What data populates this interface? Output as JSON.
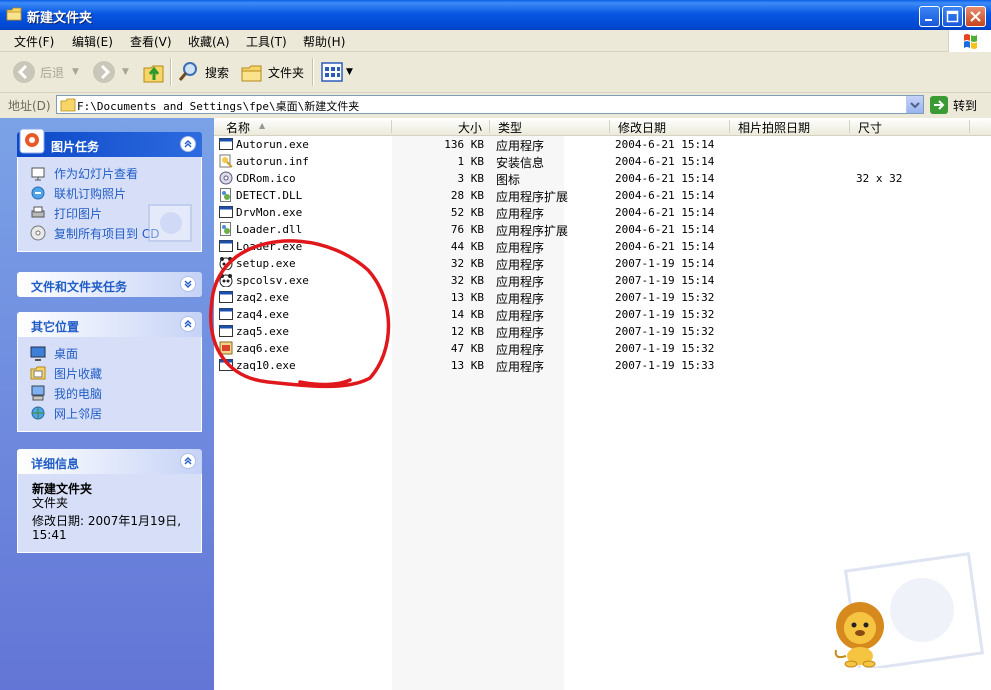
{
  "window": {
    "title": "新建文件夹"
  },
  "menu": [
    "文件(F)",
    "编辑(E)",
    "查看(V)",
    "收藏(A)",
    "工具(T)",
    "帮助(H)"
  ],
  "toolbar": {
    "back": "后退",
    "search": "搜索",
    "folders": "文件夹"
  },
  "address": {
    "label": "地址(D)",
    "path": "F:\\Documents and Settings\\fpe\\桌面\\新建文件夹",
    "go": "转到"
  },
  "left": {
    "picture_tasks": {
      "title": "图片任务",
      "items": [
        "作为幻灯片查看",
        "联机订购照片",
        "打印图片",
        "复制所有项目到 CD"
      ]
    },
    "file_tasks": {
      "title": "文件和文件夹任务"
    },
    "other_places": {
      "title": "其它位置",
      "items": [
        "桌面",
        "图片收藏",
        "我的电脑",
        "网上邻居"
      ]
    },
    "details": {
      "title": "详细信息",
      "name": "新建文件夹",
      "type": "文件夹",
      "modified_label": "修改日期: 2007年1月19日,",
      "modified_time": "15:41"
    }
  },
  "columns": [
    "名称",
    "大小",
    "类型",
    "修改日期",
    "相片拍照日期",
    "尺寸"
  ],
  "files": [
    {
      "name": "Autorun.exe",
      "size": "136 KB",
      "type": "应用程序",
      "date": "2004-6-21 15:14",
      "dim": "",
      "icon": "exe-window-icon"
    },
    {
      "name": "autorun.inf",
      "size": "1 KB",
      "type": "安装信息",
      "date": "2004-6-21 15:14",
      "dim": "",
      "icon": "inf-setup-icon"
    },
    {
      "name": "CDRom.ico",
      "size": "3 KB",
      "type": "图标",
      "date": "2004-6-21 15:14",
      "dim": "32 x 32",
      "icon": "cd-icon"
    },
    {
      "name": "DETECT.DLL",
      "size": "28 KB",
      "type": "应用程序扩展",
      "date": "2004-6-21 15:14",
      "dim": "",
      "icon": "dll-icon"
    },
    {
      "name": "DrvMon.exe",
      "size": "52 KB",
      "type": "应用程序",
      "date": "2004-6-21 15:14",
      "dim": "",
      "icon": "exe-window-icon"
    },
    {
      "name": "Loader.dll",
      "size": "76 KB",
      "type": "应用程序扩展",
      "date": "2004-6-21 15:14",
      "dim": "",
      "icon": "dll-icon"
    },
    {
      "name": "Loader.exe",
      "size": "44 KB",
      "type": "应用程序",
      "date": "2004-6-21 15:14",
      "dim": "",
      "icon": "exe-window-icon"
    },
    {
      "name": "setup.exe",
      "size": "32 KB",
      "type": "应用程序",
      "date": "2007-1-19 15:14",
      "dim": "",
      "icon": "panda-icon"
    },
    {
      "name": "spcolsv.exe",
      "size": "32 KB",
      "type": "应用程序",
      "date": "2007-1-19 15:14",
      "dim": "",
      "icon": "panda-icon"
    },
    {
      "name": "zaq2.exe",
      "size": "13 KB",
      "type": "应用程序",
      "date": "2007-1-19 15:32",
      "dim": "",
      "icon": "exe-window-icon"
    },
    {
      "name": "zaq4.exe",
      "size": "14 KB",
      "type": "应用程序",
      "date": "2007-1-19 15:32",
      "dim": "",
      "icon": "exe-window-icon"
    },
    {
      "name": "zaq5.exe",
      "size": "12 KB",
      "type": "应用程序",
      "date": "2007-1-19 15:32",
      "dim": "",
      "icon": "exe-window-icon"
    },
    {
      "name": "zaq6.exe",
      "size": "47 KB",
      "type": "应用程序",
      "date": "2007-1-19 15:32",
      "dim": "",
      "icon": "program-icon"
    },
    {
      "name": "zaq10.exe",
      "size": "13 KB",
      "type": "应用程序",
      "date": "2007-1-19 15:33",
      "dim": "",
      "icon": "exe-window-icon"
    }
  ],
  "colors": {
    "title_blue": "#0147D1",
    "task_link": "#215DC6",
    "annotation_red": "#E0181C"
  }
}
